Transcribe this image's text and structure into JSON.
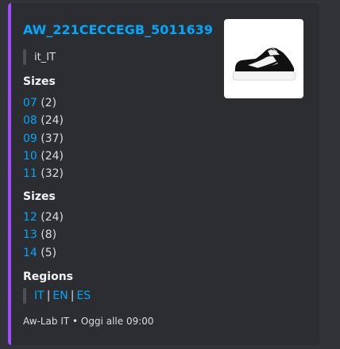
{
  "embed": {
    "accent_color": "#9b4dff",
    "title": "AW_221CECCEGB_5011639",
    "title_color": "#00a8fc",
    "locale": "it_IT",
    "thumbnail_icon": "sneaker-product-image",
    "fields": [
      {
        "name": "Sizes",
        "entries": [
          {
            "size": "07",
            "qty": "(2)"
          },
          {
            "size": "08",
            "qty": "(24)"
          },
          {
            "size": "09",
            "qty": "(37)"
          },
          {
            "size": "10",
            "qty": "(24)"
          },
          {
            "size": "11",
            "qty": "(32)"
          }
        ]
      },
      {
        "name": "Sizes",
        "entries": [
          {
            "size": "12",
            "qty": "(24)"
          },
          {
            "size": "13",
            "qty": "(8)"
          },
          {
            "size": "14",
            "qty": "(5)"
          }
        ]
      }
    ],
    "regions": {
      "name": "Regions",
      "items": [
        "IT",
        "EN",
        "ES"
      ],
      "separator": "|"
    },
    "footer": "Aw-Lab IT • Oggi alle 09:00"
  }
}
